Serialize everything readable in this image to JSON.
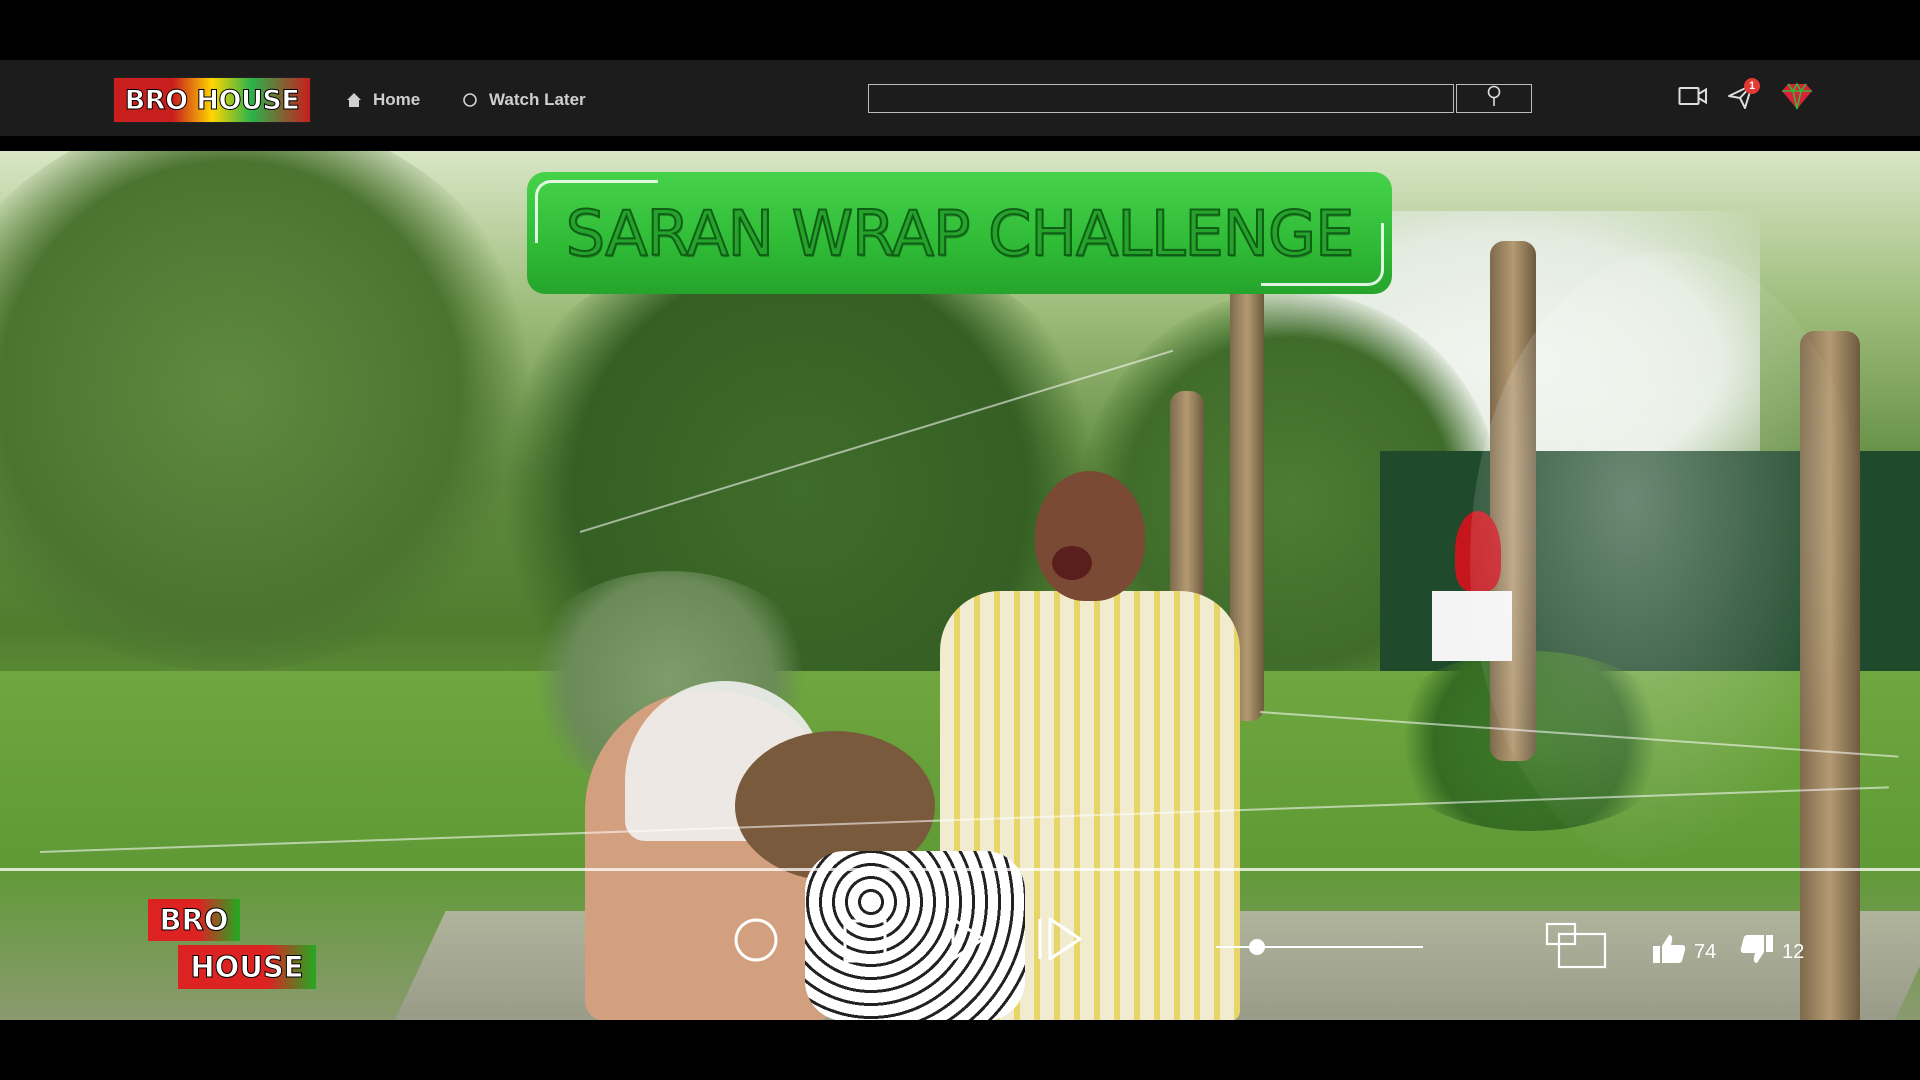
{
  "header": {
    "logo_text": "BRO HOUSE",
    "nav": [
      {
        "label": "Home",
        "icon": "home-icon"
      },
      {
        "label": "Watch Later",
        "icon": "circle-icon"
      }
    ],
    "search": {
      "placeholder": "",
      "value": "",
      "button_icon": "search-icon"
    },
    "actions": [
      {
        "icon": "video-camera-icon"
      },
      {
        "icon": "send-icon",
        "badge": "1"
      },
      {
        "icon": "gem-icon"
      }
    ]
  },
  "video": {
    "title": "SARAN WRAP CHALLENGE",
    "watermark": {
      "line1": "BRO",
      "line2": "HOUSE"
    },
    "controls": {
      "buttons": [
        "record-icon",
        "stop-icon",
        "play-icon",
        "skip-next-icon",
        "picture-in-picture-icon"
      ],
      "volume_level": 0.2
    },
    "likes": "74",
    "dislikes": "12"
  },
  "colors": {
    "header_bg": "#1c1c1c",
    "title_green": "#2fbb36",
    "logo_red": "#c81e1e",
    "badge_red": "#e53935"
  }
}
